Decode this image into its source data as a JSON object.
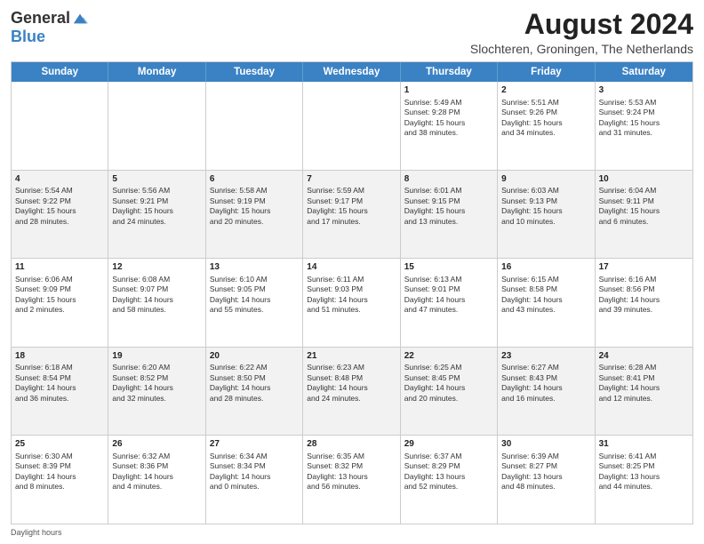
{
  "header": {
    "logo_general": "General",
    "logo_blue": "Blue",
    "main_title": "August 2024",
    "subtitle": "Slochteren, Groningen, The Netherlands"
  },
  "calendar": {
    "headers": [
      "Sunday",
      "Monday",
      "Tuesday",
      "Wednesday",
      "Thursday",
      "Friday",
      "Saturday"
    ],
    "rows": [
      [
        {
          "day": "",
          "content": ""
        },
        {
          "day": "",
          "content": ""
        },
        {
          "day": "",
          "content": ""
        },
        {
          "day": "",
          "content": ""
        },
        {
          "day": "1",
          "content": "Sunrise: 5:49 AM\nSunset: 9:28 PM\nDaylight: 15 hours\nand 38 minutes."
        },
        {
          "day": "2",
          "content": "Sunrise: 5:51 AM\nSunset: 9:26 PM\nDaylight: 15 hours\nand 34 minutes."
        },
        {
          "day": "3",
          "content": "Sunrise: 5:53 AM\nSunset: 9:24 PM\nDaylight: 15 hours\nand 31 minutes."
        }
      ],
      [
        {
          "day": "4",
          "content": "Sunrise: 5:54 AM\nSunset: 9:22 PM\nDaylight: 15 hours\nand 28 minutes."
        },
        {
          "day": "5",
          "content": "Sunrise: 5:56 AM\nSunset: 9:21 PM\nDaylight: 15 hours\nand 24 minutes."
        },
        {
          "day": "6",
          "content": "Sunrise: 5:58 AM\nSunset: 9:19 PM\nDaylight: 15 hours\nand 20 minutes."
        },
        {
          "day": "7",
          "content": "Sunrise: 5:59 AM\nSunset: 9:17 PM\nDaylight: 15 hours\nand 17 minutes."
        },
        {
          "day": "8",
          "content": "Sunrise: 6:01 AM\nSunset: 9:15 PM\nDaylight: 15 hours\nand 13 minutes."
        },
        {
          "day": "9",
          "content": "Sunrise: 6:03 AM\nSunset: 9:13 PM\nDaylight: 15 hours\nand 10 minutes."
        },
        {
          "day": "10",
          "content": "Sunrise: 6:04 AM\nSunset: 9:11 PM\nDaylight: 15 hours\nand 6 minutes."
        }
      ],
      [
        {
          "day": "11",
          "content": "Sunrise: 6:06 AM\nSunset: 9:09 PM\nDaylight: 15 hours\nand 2 minutes."
        },
        {
          "day": "12",
          "content": "Sunrise: 6:08 AM\nSunset: 9:07 PM\nDaylight: 14 hours\nand 58 minutes."
        },
        {
          "day": "13",
          "content": "Sunrise: 6:10 AM\nSunset: 9:05 PM\nDaylight: 14 hours\nand 55 minutes."
        },
        {
          "day": "14",
          "content": "Sunrise: 6:11 AM\nSunset: 9:03 PM\nDaylight: 14 hours\nand 51 minutes."
        },
        {
          "day": "15",
          "content": "Sunrise: 6:13 AM\nSunset: 9:01 PM\nDaylight: 14 hours\nand 47 minutes."
        },
        {
          "day": "16",
          "content": "Sunrise: 6:15 AM\nSunset: 8:58 PM\nDaylight: 14 hours\nand 43 minutes."
        },
        {
          "day": "17",
          "content": "Sunrise: 6:16 AM\nSunset: 8:56 PM\nDaylight: 14 hours\nand 39 minutes."
        }
      ],
      [
        {
          "day": "18",
          "content": "Sunrise: 6:18 AM\nSunset: 8:54 PM\nDaylight: 14 hours\nand 36 minutes."
        },
        {
          "day": "19",
          "content": "Sunrise: 6:20 AM\nSunset: 8:52 PM\nDaylight: 14 hours\nand 32 minutes."
        },
        {
          "day": "20",
          "content": "Sunrise: 6:22 AM\nSunset: 8:50 PM\nDaylight: 14 hours\nand 28 minutes."
        },
        {
          "day": "21",
          "content": "Sunrise: 6:23 AM\nSunset: 8:48 PM\nDaylight: 14 hours\nand 24 minutes."
        },
        {
          "day": "22",
          "content": "Sunrise: 6:25 AM\nSunset: 8:45 PM\nDaylight: 14 hours\nand 20 minutes."
        },
        {
          "day": "23",
          "content": "Sunrise: 6:27 AM\nSunset: 8:43 PM\nDaylight: 14 hours\nand 16 minutes."
        },
        {
          "day": "24",
          "content": "Sunrise: 6:28 AM\nSunset: 8:41 PM\nDaylight: 14 hours\nand 12 minutes."
        }
      ],
      [
        {
          "day": "25",
          "content": "Sunrise: 6:30 AM\nSunset: 8:39 PM\nDaylight: 14 hours\nand 8 minutes."
        },
        {
          "day": "26",
          "content": "Sunrise: 6:32 AM\nSunset: 8:36 PM\nDaylight: 14 hours\nand 4 minutes."
        },
        {
          "day": "27",
          "content": "Sunrise: 6:34 AM\nSunset: 8:34 PM\nDaylight: 14 hours\nand 0 minutes."
        },
        {
          "day": "28",
          "content": "Sunrise: 6:35 AM\nSunset: 8:32 PM\nDaylight: 13 hours\nand 56 minutes."
        },
        {
          "day": "29",
          "content": "Sunrise: 6:37 AM\nSunset: 8:29 PM\nDaylight: 13 hours\nand 52 minutes."
        },
        {
          "day": "30",
          "content": "Sunrise: 6:39 AM\nSunset: 8:27 PM\nDaylight: 13 hours\nand 48 minutes."
        },
        {
          "day": "31",
          "content": "Sunrise: 6:41 AM\nSunset: 8:25 PM\nDaylight: 13 hours\nand 44 minutes."
        }
      ]
    ]
  },
  "footer": {
    "daylight_hours_label": "Daylight hours"
  }
}
